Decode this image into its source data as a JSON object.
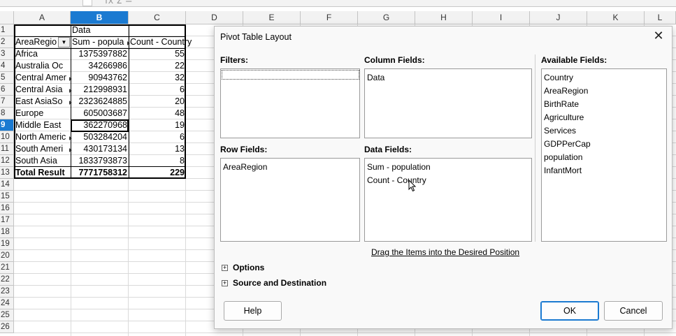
{
  "formula_bar": {
    "fx": "fx  Σ  ="
  },
  "sheet": {
    "columns": [
      "A",
      "B",
      "C",
      "D",
      "E",
      "F",
      "G",
      "H",
      "I",
      "J",
      "K",
      "L"
    ],
    "selected_column": "B",
    "rows": [
      "1",
      "2",
      "3",
      "4",
      "5",
      "6",
      "7",
      "8",
      "9",
      "10",
      "11",
      "12",
      "13",
      "14",
      "15",
      "16",
      "17",
      "18",
      "19",
      "20",
      "21",
      "22",
      "23",
      "24",
      "25",
      "26"
    ],
    "selected_row": "9",
    "cells": {
      "r1": {
        "b": "Data"
      },
      "r2": {
        "a": "AreaRegio",
        "b": "Sum - popula",
        "c": "Count - Country"
      },
      "data_rows": [
        {
          "a": "Africa",
          "b": "1375397882",
          "c": "55"
        },
        {
          "a": "Australia  Oc",
          "b": "34266986",
          "c": "22"
        },
        {
          "a": "Central Amer",
          "b": "90943762",
          "c": "32"
        },
        {
          "a": "Central Asia",
          "b": "212998931",
          "c": "6"
        },
        {
          "a": "East AsiaSo",
          "b": "2323624885",
          "c": "20"
        },
        {
          "a": "Europe",
          "b": "605003687",
          "c": "48"
        },
        {
          "a": "Middle East",
          "b": "362270968",
          "c": "19"
        },
        {
          "a": "North Americ",
          "b": "503284204",
          "c": "6"
        },
        {
          "a": "South Ameri",
          "b": "430173134",
          "c": "13"
        },
        {
          "a": "South Asia",
          "b": "1833793873",
          "c": "8"
        }
      ],
      "total": {
        "a": "Total Result",
        "b": "7771758312",
        "c": "229"
      }
    }
  },
  "dialog": {
    "title": "Pivot Table Layout",
    "close_glyph": "✕",
    "filters_label": "Filters:",
    "column_fields_label": "Column Fields:",
    "column_fields": [
      "Data"
    ],
    "row_fields_label": "Row Fields:",
    "row_fields": [
      "AreaRegion"
    ],
    "data_fields_label": "Data Fields:",
    "data_fields": [
      "Sum - population",
      "Count - Country"
    ],
    "available_fields_label": "Available Fields:",
    "available_fields": [
      "Country",
      "AreaRegion",
      "BirthRate",
      "Agriculture",
      "Services",
      "GDPPerCap",
      "population",
      "InfantMort"
    ],
    "hint": "Drag the Items into the Desired Position",
    "options_label": "Options",
    "source_label": "Source and Destination",
    "help_button": "Help",
    "ok_button": "OK",
    "cancel_button": "Cancel"
  }
}
